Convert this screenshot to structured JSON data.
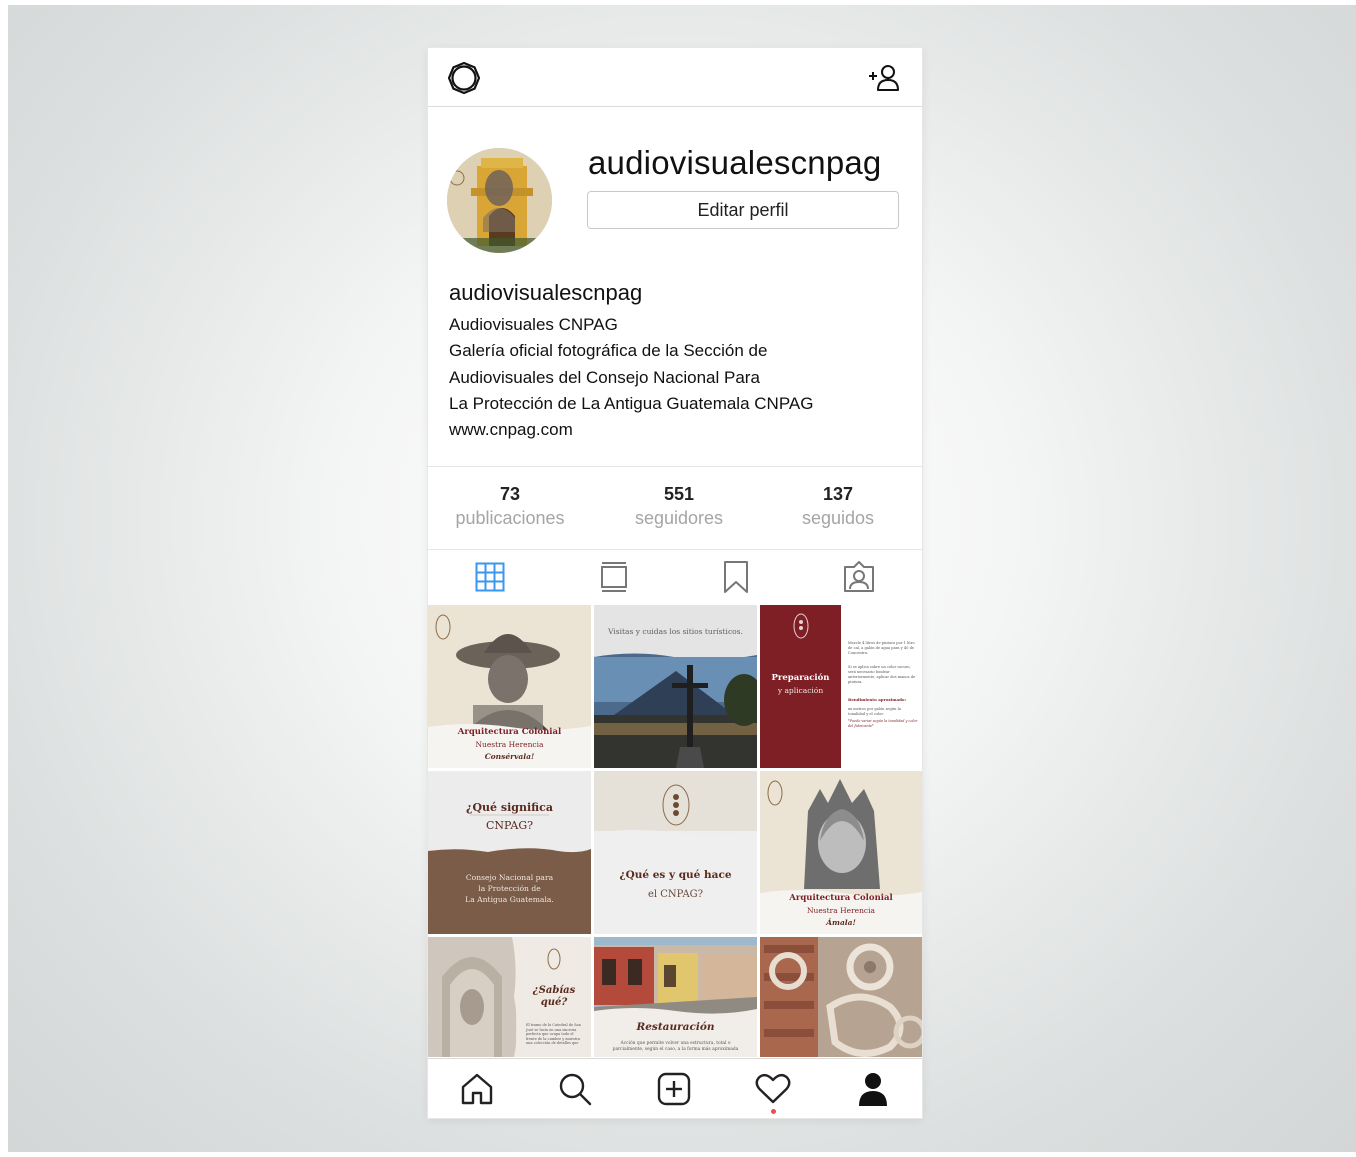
{
  "profile": {
    "username": "audiovisualescnpag",
    "edit_label": "Editar perfil",
    "bio_name": "audiovisualescnpag",
    "bio_lines": [
      "Audiovisuales CNPAG",
      "Galería oficial fotográfica de la Sección de",
      "Audiovisuales del Consejo Nacional Para",
      "La Protección de La Antigua Guatemala CNPAG",
      "www.cnpag.com"
    ]
  },
  "stats": [
    {
      "num": "73",
      "label": "publicaciones"
    },
    {
      "num": "551",
      "label": "seguidores"
    },
    {
      "num": "137",
      "label": "seguidos"
    }
  ],
  "tabs": [
    "grid-icon",
    "feed-icon",
    "saved-icon",
    "tagged-icon"
  ],
  "posts": {
    "p1": {
      "title": "Arquitectura Colonial",
      "sub": "Nuestra Herencia",
      "tag": "Consérvala!"
    },
    "p2": {
      "caption": "Visitas y cuidas los sitios turísticos."
    },
    "p3": {
      "title": "Preparación",
      "sub": "y aplicación",
      "bullets": [
        "Mezcle 4 litros de pintura por 1 litro de cal, a galón de agua para y 40 de Concentra.",
        "Si se aplica sobre un color oscuro, será necesario fondear anteriormente, aplicar dos manos de pintura."
      ],
      "yield_title": "Rendimiento aproximado:",
      "yield_text": "xx metros por galón según la tonalidad y el color.",
      "note": "*Puede variar según la tonalidad y color del fabricante*"
    },
    "p4": {
      "title": "¿Qué significa",
      "sub": "CNPAG?",
      "body": [
        "Consejo Nacional para",
        "la Protección de",
        "La Antigua Guatemala."
      ]
    },
    "p5": {
      "title": "¿Qué es y qué hace",
      "sub": "el CNPAG?"
    },
    "p6": {
      "title": "Arquitectura Colonial",
      "sub": "Nuestra Herencia",
      "tag": "Ámala!"
    },
    "p7": {
      "title": "¿Sabías qué?",
      "body": "El tramo de la Catedral de San José se lucía en una sinceria perfecta que ocupa todo el frente de la cumbre y muestra una colección de detalles que"
    },
    "p8": {
      "title": "Restauración",
      "body": "Acción que permite volver una estructura, total o parcialmente, según el caso, a la forma más aproximada"
    }
  },
  "colors": {
    "accent": "#3897f0",
    "maroon": "#7d1f24",
    "brown": "#7a5c48",
    "notification": "#ed4956"
  },
  "nav": [
    "home-icon",
    "search-icon",
    "add-post-icon",
    "heart-icon",
    "profile-icon"
  ]
}
